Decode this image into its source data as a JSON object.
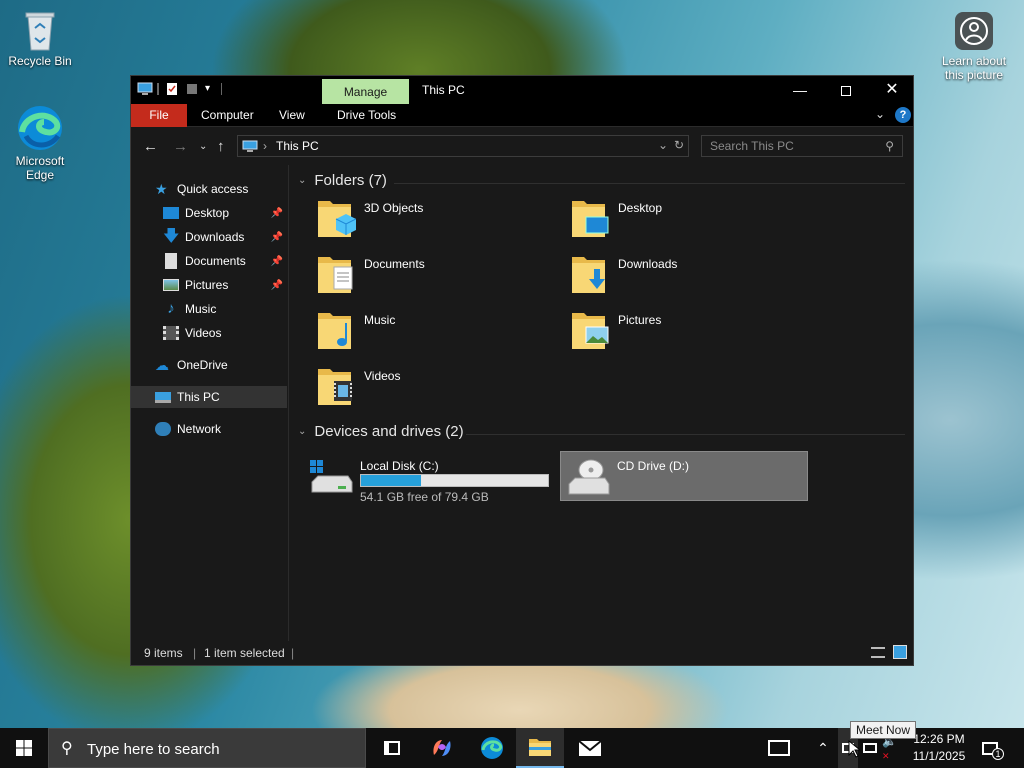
{
  "desktop": {
    "recycle_bin": "Recycle Bin",
    "edge_line1": "Microsoft",
    "edge_line2": "Edge",
    "learn_line1": "Learn about",
    "learn_line2": "this picture"
  },
  "window": {
    "title": "This PC",
    "manage_tab": "Manage",
    "ribbon": {
      "file": "File",
      "computer": "Computer",
      "view": "View",
      "drive_tools": "Drive Tools"
    },
    "address_crumb": "This PC",
    "search_placeholder": "Search This PC",
    "nav": {
      "quick_access": "Quick access",
      "desktop": "Desktop",
      "downloads": "Downloads",
      "documents": "Documents",
      "pictures": "Pictures",
      "music": "Music",
      "videos": "Videos",
      "onedrive": "OneDrive",
      "this_pc": "This PC",
      "network": "Network"
    },
    "folders_header": "Folders (7)",
    "folders": [
      "3D Objects",
      "Desktop",
      "Documents",
      "Downloads",
      "Music",
      "Pictures",
      "Videos"
    ],
    "devices_header": "Devices and drives (2)",
    "drives": [
      {
        "name": "Local Disk (C:)",
        "free": "54.1 GB free of 79.4 GB",
        "used_fraction": 0.319
      },
      {
        "name": "CD Drive (D:)"
      }
    ],
    "status": {
      "items": "9 items",
      "selected": "1 item selected"
    }
  },
  "taskbar": {
    "search_placeholder": "Type here to search",
    "clock_time": "12:26 PM",
    "clock_date": "11/1/2025",
    "notification_count": "1",
    "tooltip": "Meet Now"
  },
  "colors": {
    "file_tab": "#c42b1c",
    "manage_tab": "#b7e4a3",
    "accent": "#26a0da"
  }
}
